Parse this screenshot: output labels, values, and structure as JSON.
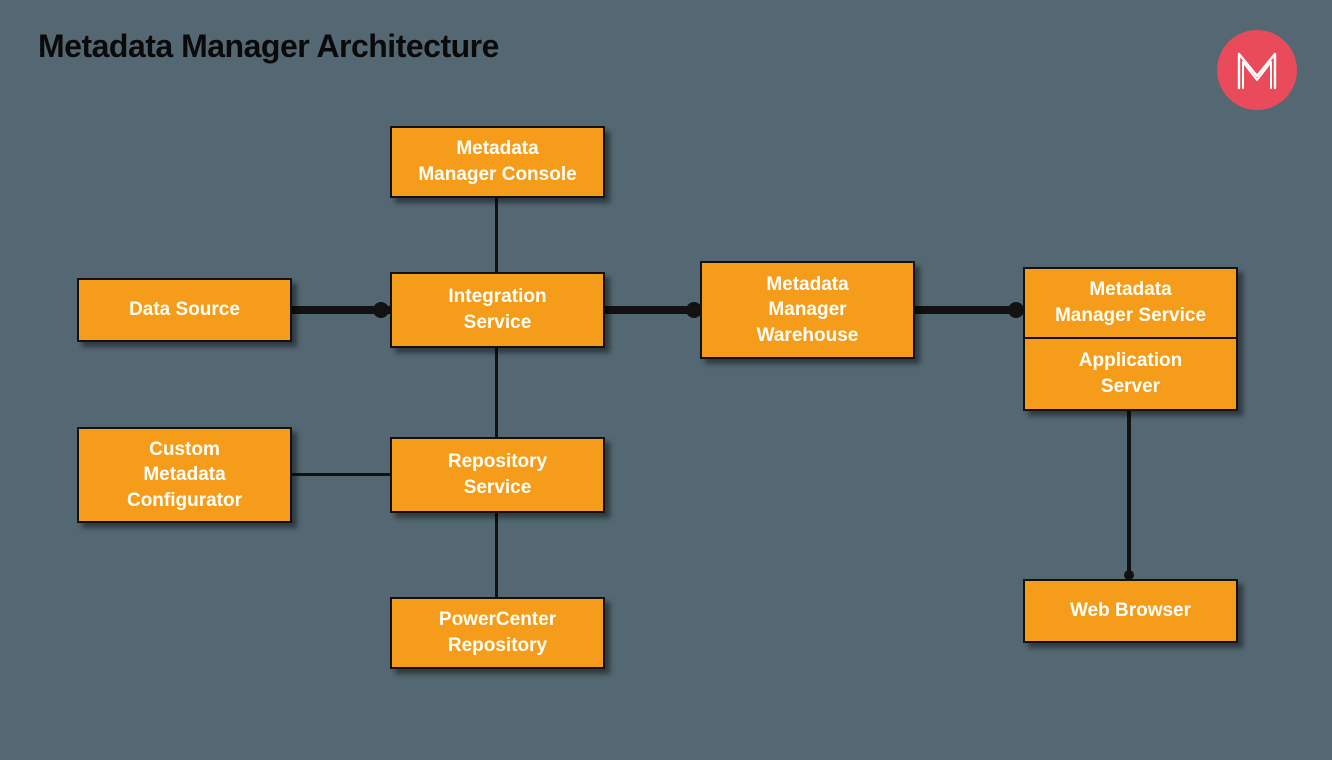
{
  "title": "Metadata Manager Architecture",
  "logo": {
    "letter": "M"
  },
  "boxes": {
    "data_source": "Data Source",
    "metadata_manager_console": "Metadata\nManager Console",
    "integration_service": "Integration\nService",
    "metadata_manager_warehouse": "Metadata\nManager\nWarehouse",
    "metadata_manager_service": "Metadata\nManager Service",
    "application_server": "Application\nServer",
    "custom_metadata_configurator": "Custom\nMetadata\nConfigurator",
    "repository_service": "Repository\nService",
    "powercenter_repository": "PowerCenter\nRepository",
    "web_browser": "Web Browser"
  }
}
